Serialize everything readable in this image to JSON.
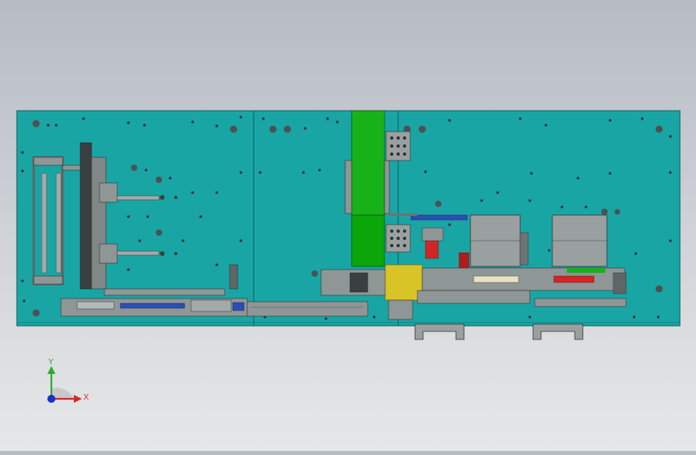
{
  "viewport": {
    "background_top": "#b7bcc4",
    "background_bottom": "#e6e7e8"
  },
  "model": {
    "plate_color": "#1aa5a5",
    "plate_edge_color": "#0e5f60",
    "accent_green": "#17b21a",
    "hole_color": "#5a5a5a",
    "component_color": "#8f9696",
    "yellow_color": "#d8c427",
    "red_color": "#d22525",
    "blue_color": "#2c4fb3"
  },
  "triad": {
    "y_label": "Y",
    "x_label": "X",
    "y_color": "#2faa2f",
    "x_color": "#d42a2a",
    "z_color": "#1c2fd0"
  }
}
